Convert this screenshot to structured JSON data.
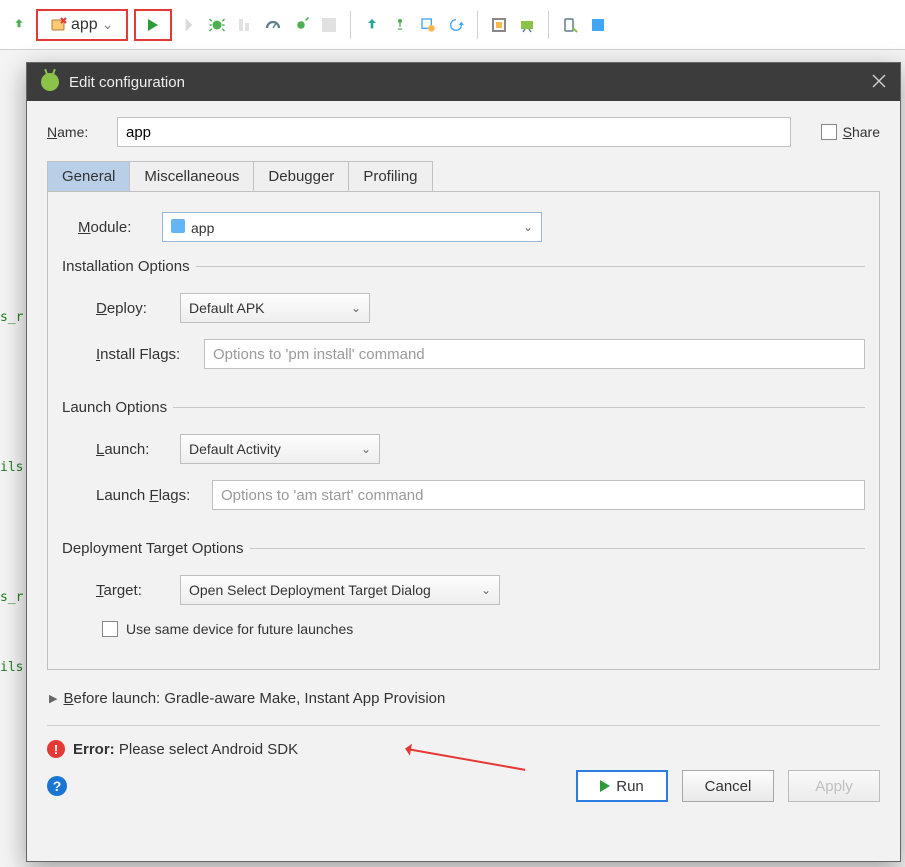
{
  "toolbar": {
    "run_config": "app"
  },
  "dialog": {
    "title": "Edit configuration",
    "name_label": "Name:",
    "name_value": "app",
    "share_label": "Share",
    "tabs": [
      "General",
      "Miscellaneous",
      "Debugger",
      "Profiling"
    ],
    "module_label": "Module:",
    "module_value": "app",
    "installation": {
      "legend": "Installation Options",
      "deploy_label": "Deploy:",
      "deploy_value": "Default APK",
      "install_flags_label": "Install Flags:",
      "install_flags_placeholder": "Options to 'pm install' command"
    },
    "launch": {
      "legend": "Launch Options",
      "launch_label": "Launch:",
      "launch_value": "Default Activity",
      "launch_flags_label": "Launch Flags:",
      "launch_flags_placeholder": "Options to 'am start' command"
    },
    "deployment": {
      "legend": "Deployment Target Options",
      "target_label": "Target:",
      "target_value": "Open Select Deployment Target Dialog",
      "same_device_label": "Use same device for future launches"
    },
    "before_launch": "Before launch: Gradle-aware Make, Instant App Provision",
    "error_prefix": "Error:",
    "error_message": " Please select Android SDK",
    "buttons": {
      "run": "Run",
      "cancel": "Cancel",
      "apply": "Apply"
    }
  },
  "gutter": {
    "frag1": "s_r",
    "frag2": "ils",
    "frag3": "s_r",
    "frag4": "ils"
  }
}
